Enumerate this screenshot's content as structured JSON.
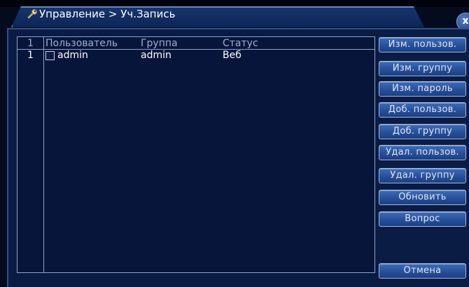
{
  "window": {
    "title": "Управление > Уч.Запись",
    "close_label": "x"
  },
  "table": {
    "header": {
      "count": "1",
      "user": "Пользователь",
      "group": "Группа",
      "status": "Статус"
    },
    "rows": [
      {
        "index": "1",
        "user": "admin",
        "group": "admin",
        "status": "Веб",
        "checked": false
      }
    ]
  },
  "buttons": {
    "edit_user": "Изм. пользов.",
    "edit_group": "Изм. группу",
    "edit_password": "Изм. пароль",
    "add_user": "Доб. пользов.",
    "add_group": "Доб. группу",
    "delete_user": "Удал. пользов.",
    "delete_group": "Удал. группу",
    "refresh": "Обновить",
    "question": "Вопрос",
    "cancel": "Отмена"
  },
  "colors": {
    "background": "#0b1c44",
    "button": "#27509a",
    "text": "#ffffff"
  },
  "icons": {
    "title_icon": "tools-icon",
    "close_icon": "close-icon"
  }
}
